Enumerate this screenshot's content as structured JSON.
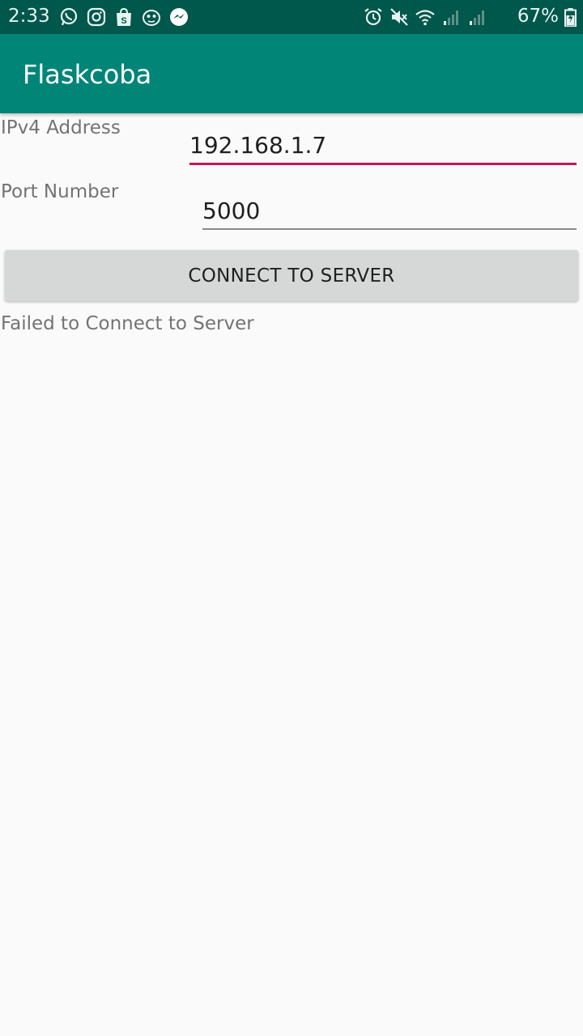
{
  "status_bar": {
    "time": "2:33",
    "battery": "67%",
    "left_icons": [
      "whatsapp-icon",
      "instagram-icon",
      "shopping-bag-icon",
      "mascot-app-icon",
      "messenger-icon"
    ],
    "right_icons": [
      "alarm-icon",
      "mute-icon",
      "wifi-icon",
      "signal-icon",
      "signal-icon",
      "battery-icon"
    ]
  },
  "app_bar": {
    "title": "Flaskcoba"
  },
  "form": {
    "ip_label": "IPv4 Address",
    "ip_value": "192.168.1.7",
    "port_label": "Port Number",
    "port_value": "5000",
    "connect_label": "CONNECT TO SERVER"
  },
  "status": {
    "message": "Failed to Connect to Server"
  },
  "colors": {
    "status_bar": "#00574b",
    "app_bar": "#008577",
    "accent": "#c2185b",
    "background": "#fafafa"
  }
}
